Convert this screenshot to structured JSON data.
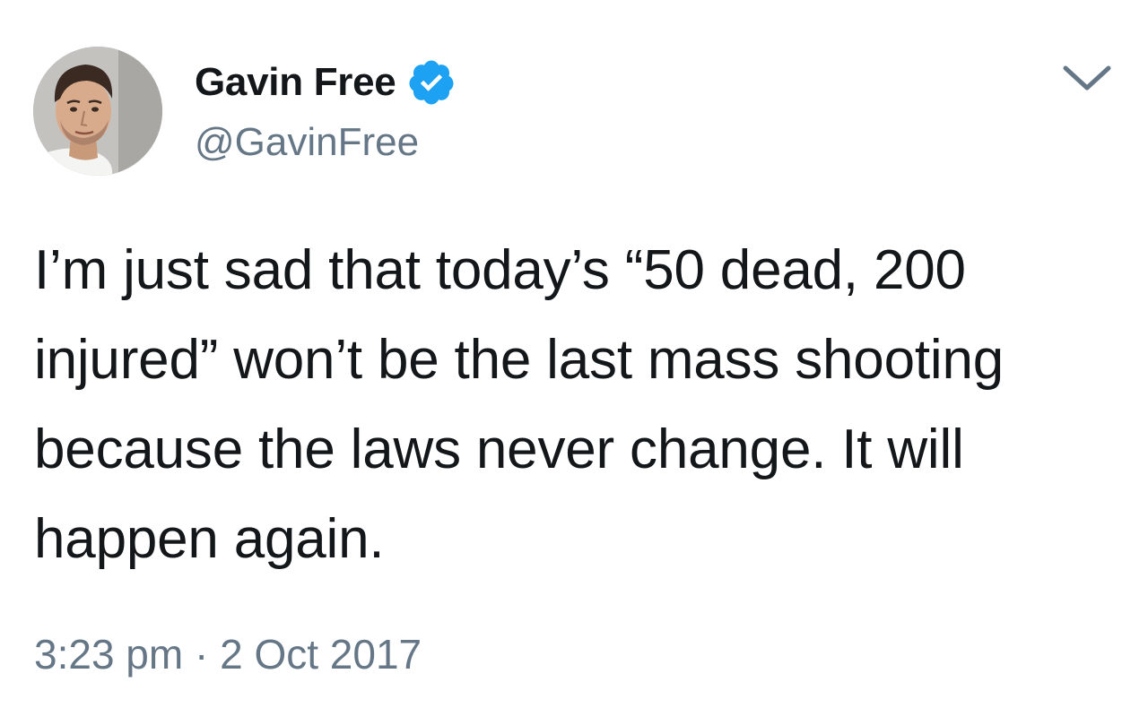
{
  "tweet": {
    "author": {
      "display_name": "Gavin Free",
      "handle": "@GavinFree",
      "verified": true
    },
    "text": "I’m just sad that today’s “50 dead, 200 injured” won’t be the last mass shooting because the laws never change. It will happen again.",
    "timestamp": "3:23 pm · 2 Oct 2017"
  },
  "icons": {
    "avatar": "user-avatar",
    "verified": "verified-badge-icon",
    "menu": "chevron-down-icon"
  },
  "colors": {
    "text": "#14171a",
    "secondary": "#657786",
    "verified": "#1da1f2",
    "background": "#ffffff"
  }
}
